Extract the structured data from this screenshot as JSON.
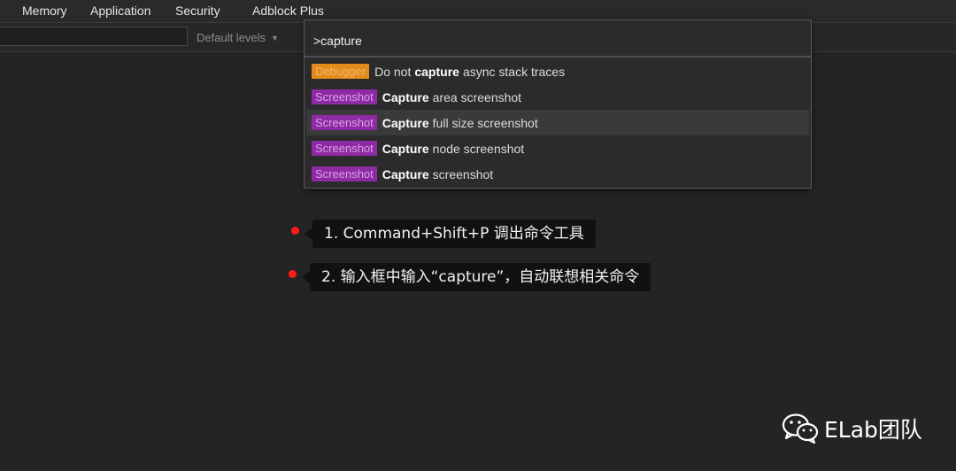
{
  "tabs": [
    "Memory",
    "Application",
    "Security",
    "Adblock Plus"
  ],
  "toolbar": {
    "filter_value": "",
    "levels_label": "Default levels",
    "levels_caret": "▼"
  },
  "command_menu": {
    "query": ">capture",
    "items": [
      {
        "badge": "Debugger",
        "pre": "Do not",
        "match": "capture",
        "post": "async stack traces"
      },
      {
        "badge": "Screenshot",
        "pre": "",
        "match": "Capture",
        "post": "area screenshot"
      },
      {
        "badge": "Screenshot",
        "pre": "",
        "match": "Capture",
        "post": "full size screenshot"
      },
      {
        "badge": "Screenshot",
        "pre": "",
        "match": "Capture",
        "post": "node screenshot"
      },
      {
        "badge": "Screenshot",
        "pre": "",
        "match": "Capture",
        "post": "screenshot"
      }
    ],
    "selected_index": 2
  },
  "annotations": [
    "1. Command+Shift+P 调出命令工具",
    "2. 输入框中输入“capture”，自动联想相关命令"
  ],
  "watermark": {
    "icon": "wechat-icon",
    "text": "ELab团队"
  },
  "colors": {
    "debugger_badge": "#e38c1b",
    "screenshot_badge": "#8e2aa4",
    "annotation_dot": "#ff1a1a"
  }
}
